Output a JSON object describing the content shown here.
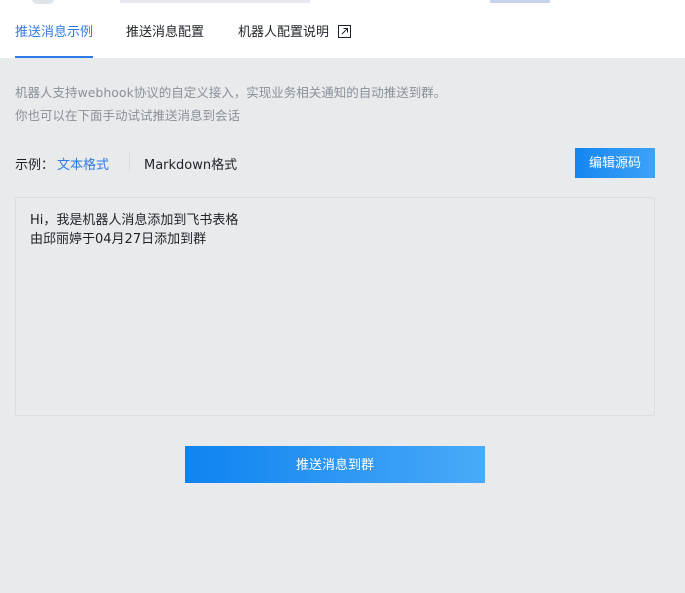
{
  "tabs": [
    {
      "label": "推送消息示例"
    },
    {
      "label": "推送消息配置"
    },
    {
      "label": "机器人配置说明"
    }
  ],
  "description": {
    "line1": "机器人支持webhook协议的自定义接入，实现业务相关通知的自动推送到群。",
    "line2": "你也可以在下面手动试试推送消息到会话"
  },
  "example": {
    "label": "示例：",
    "text_format": "文本格式",
    "markdown_format": "Markdown格式",
    "edit_source": "编辑源码"
  },
  "message": {
    "line1": "Hi，我是机器人消息添加到飞书表格",
    "line2": "由邱丽婷于04月27日添加到群"
  },
  "actions": {
    "push": "推送消息到群"
  },
  "colors": {
    "accent": "#2f7ae5",
    "button_start": "#1485f0",
    "button_end": "#3ea3f7",
    "background": "#e8eaec"
  },
  "icons": {
    "external_link": "external-link-icon"
  }
}
